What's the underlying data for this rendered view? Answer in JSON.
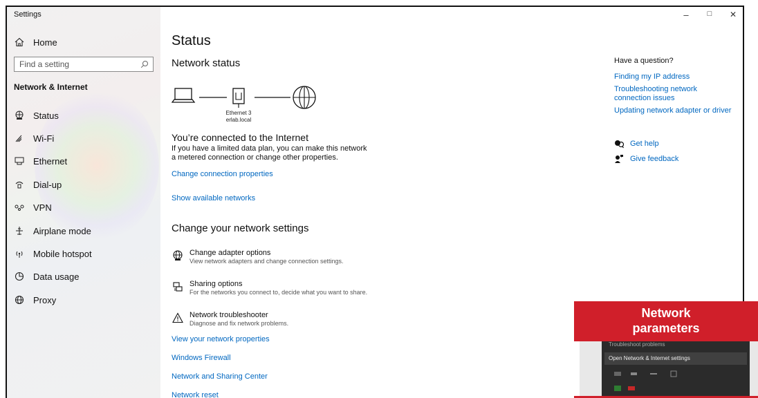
{
  "window": {
    "title": "Settings",
    "controls": {
      "minimize": "–",
      "maximize": "□",
      "close": "✕"
    }
  },
  "sidebar": {
    "home_label": "Home",
    "search_placeholder": "Find a setting",
    "section_title": "Network & Internet",
    "items": [
      {
        "label": "Status",
        "icon": "status-icon"
      },
      {
        "label": "Wi-Fi",
        "icon": "wifi-icon"
      },
      {
        "label": "Ethernet",
        "icon": "ethernet-icon"
      },
      {
        "label": "Dial-up",
        "icon": "dialup-icon"
      },
      {
        "label": "VPN",
        "icon": "vpn-icon"
      },
      {
        "label": "Airplane mode",
        "icon": "airplane-icon"
      },
      {
        "label": "Mobile hotspot",
        "icon": "hotspot-icon"
      },
      {
        "label": "Data usage",
        "icon": "data-usage-icon"
      },
      {
        "label": "Proxy",
        "icon": "proxy-icon"
      }
    ]
  },
  "main": {
    "page_title": "Status",
    "network_status_heading": "Network status",
    "adapter_name": "Ethernet 3",
    "domain_name": "erlab.local",
    "connected_heading": "You’re connected to the Internet",
    "connected_text": "If you have a limited data plan, you can make this network a metered connection or change other properties.",
    "change_connection_link": "Change connection properties",
    "show_networks_link": "Show available networks",
    "change_settings_heading": "Change your network settings",
    "options": [
      {
        "title": "Change adapter options",
        "desc": "View network adapters and change connection settings.",
        "icon": "adapter-icon"
      },
      {
        "title": "Sharing options",
        "desc": "For the networks you connect to, decide what you want to share.",
        "icon": "sharing-icon"
      },
      {
        "title": "Network troubleshooter",
        "desc": "Diagnose and fix network problems.",
        "icon": "warning-icon"
      }
    ],
    "links": {
      "view_properties": "View your network properties",
      "firewall": "Windows Firewall",
      "sharing_center": "Network and Sharing Center",
      "reset": "Network reset"
    }
  },
  "right_panel": {
    "question_heading": "Have a question?",
    "links": [
      "Finding my IP address",
      "Troubleshooting network connection issues",
      "Updating network adapter or driver"
    ],
    "get_help": "Get help",
    "give_feedback": "Give feedback"
  },
  "overlay": {
    "banner_line1": "Network",
    "banner_line2": "parameters",
    "menu_item_partial": "Troubleshoot problems",
    "menu_item": "Open Network & Internet settings",
    "accent_color": "#d01f2a"
  }
}
